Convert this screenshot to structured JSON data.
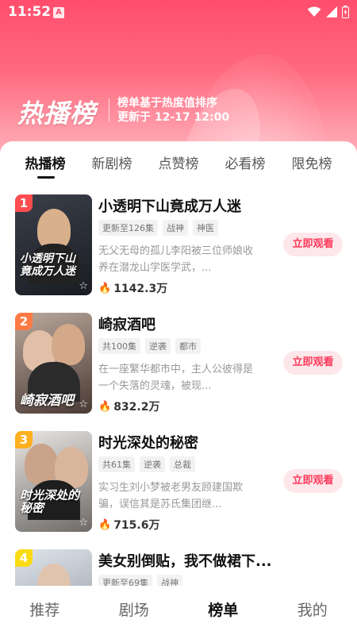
{
  "status_bar": {
    "time": "11:52",
    "app_icon": "A"
  },
  "header": {
    "title": "热播榜",
    "subtitle_line1": "榜单基于热度值排序",
    "subtitle_line2": "更新于 12-17 12:00"
  },
  "tabs": [
    {
      "label": "热播榜",
      "active": true
    },
    {
      "label": "新剧榜",
      "active": false
    },
    {
      "label": "点赞榜",
      "active": false
    },
    {
      "label": "必看榜",
      "active": false
    },
    {
      "label": "限免榜",
      "active": false
    }
  ],
  "items": [
    {
      "rank": "1",
      "rank_color": "#ff4d4f",
      "title": "小透明下山竟成万人迷",
      "tags": [
        "更新至126集",
        "战神",
        "神医"
      ],
      "desc": "无父无母的孤儿李阳被三位师娘收养在潜龙山学医学武，...",
      "heat": "1142.3万",
      "cover_caption": "小透明下山竟成万人迷",
      "button": "立即观看"
    },
    {
      "rank": "2",
      "rank_color": "#ff7a45",
      "title": "崎寂酒吧",
      "tags": [
        "共100集",
        "逆袭",
        "都市"
      ],
      "desc": "在一座繁华都市中，主人公彼得是一个失落的灵魂，被现...",
      "heat": "832.2万",
      "cover_caption": "崎寂酒吧",
      "button": "立即观看"
    },
    {
      "rank": "3",
      "rank_color": "#ffb01f",
      "title": "时光深处的秘密",
      "tags": [
        "共61集",
        "逆袭",
        "总裁"
      ],
      "desc": "实习生刘小梦被老男友顾建国欺骗，误信其是苏氏集团继...",
      "heat": "715.6万",
      "cover_caption": "时光深处的秘密",
      "button": "立即观看"
    },
    {
      "rank": "4",
      "rank_color": "#fadb14",
      "title": "美女别倒贴，我不做裙下...",
      "tags": [
        "更新至69集",
        "战神"
      ],
      "desc": "",
      "heat": "",
      "cover_caption": "",
      "button": ""
    }
  ],
  "bottom_nav": [
    {
      "label": "推荐",
      "active": false
    },
    {
      "label": "剧场",
      "active": false
    },
    {
      "label": "榜单",
      "active": true
    },
    {
      "label": "我的",
      "active": false
    }
  ],
  "colors": {
    "accent": "#ff3a5c",
    "hero_top": "#ff4d6d",
    "button_bg": "#fde7ea"
  },
  "icons": [
    "wifi-icon",
    "signal-icon",
    "battery-icon",
    "fire-icon",
    "star-icon"
  ]
}
